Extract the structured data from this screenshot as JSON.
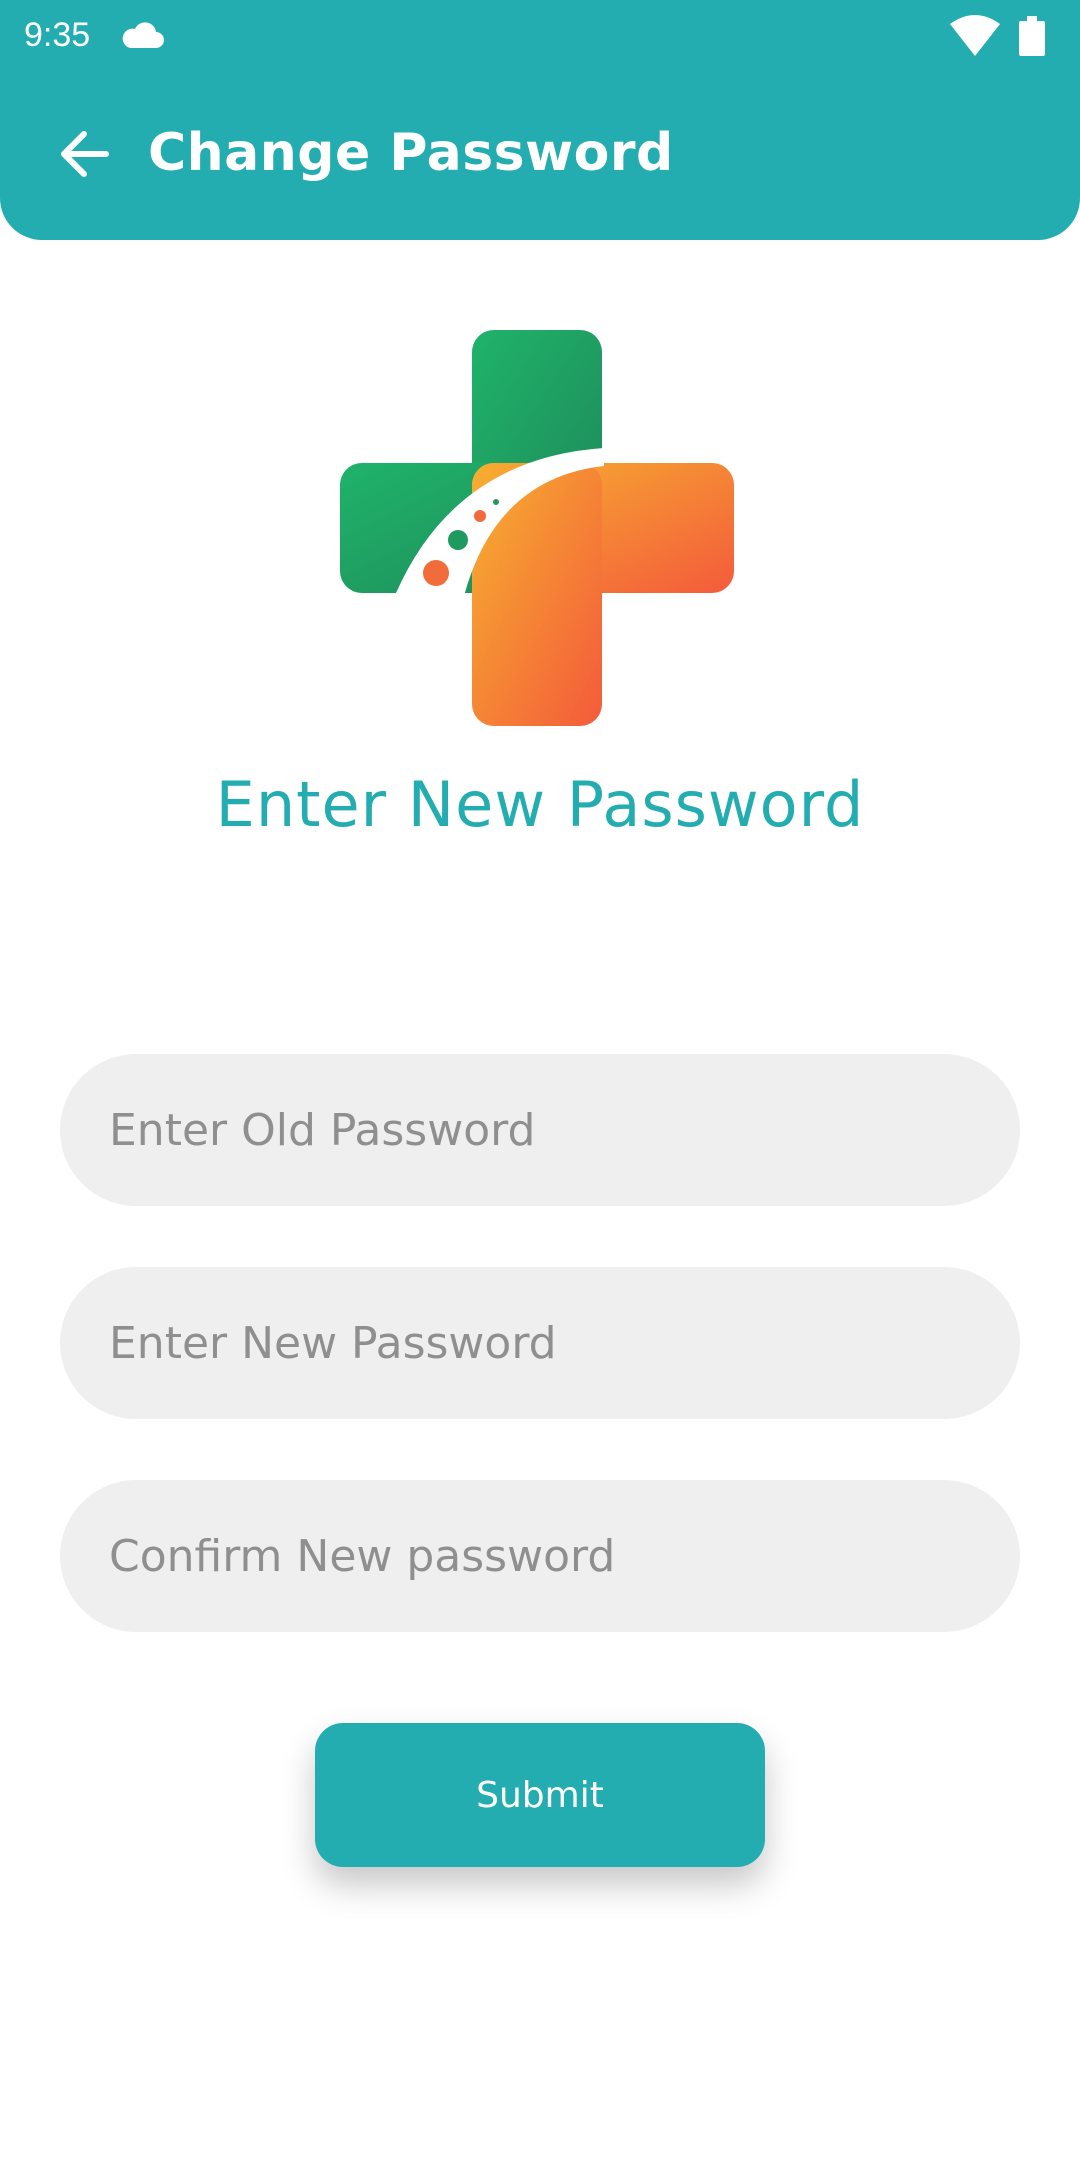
{
  "status_bar": {
    "time": "9:35",
    "icons": [
      "cloud-icon",
      "wifi-icon",
      "battery-icon"
    ]
  },
  "header": {
    "title": "Change Password",
    "back_icon": "arrow-left-icon",
    "background_color": "#24adb0"
  },
  "logo": {
    "icon": "medical-cross-logo"
  },
  "form": {
    "heading": "Enter New Password",
    "old_password": {
      "placeholder": "Enter Old Password",
      "value": ""
    },
    "new_password": {
      "placeholder": "Enter New Password",
      "value": ""
    },
    "confirm_password": {
      "placeholder": "Confirm New password",
      "value": ""
    },
    "submit_label": "Submit"
  },
  "colors": {
    "accent": "#24adb0",
    "field_background": "#efefef",
    "placeholder": "#8f8f8f"
  }
}
